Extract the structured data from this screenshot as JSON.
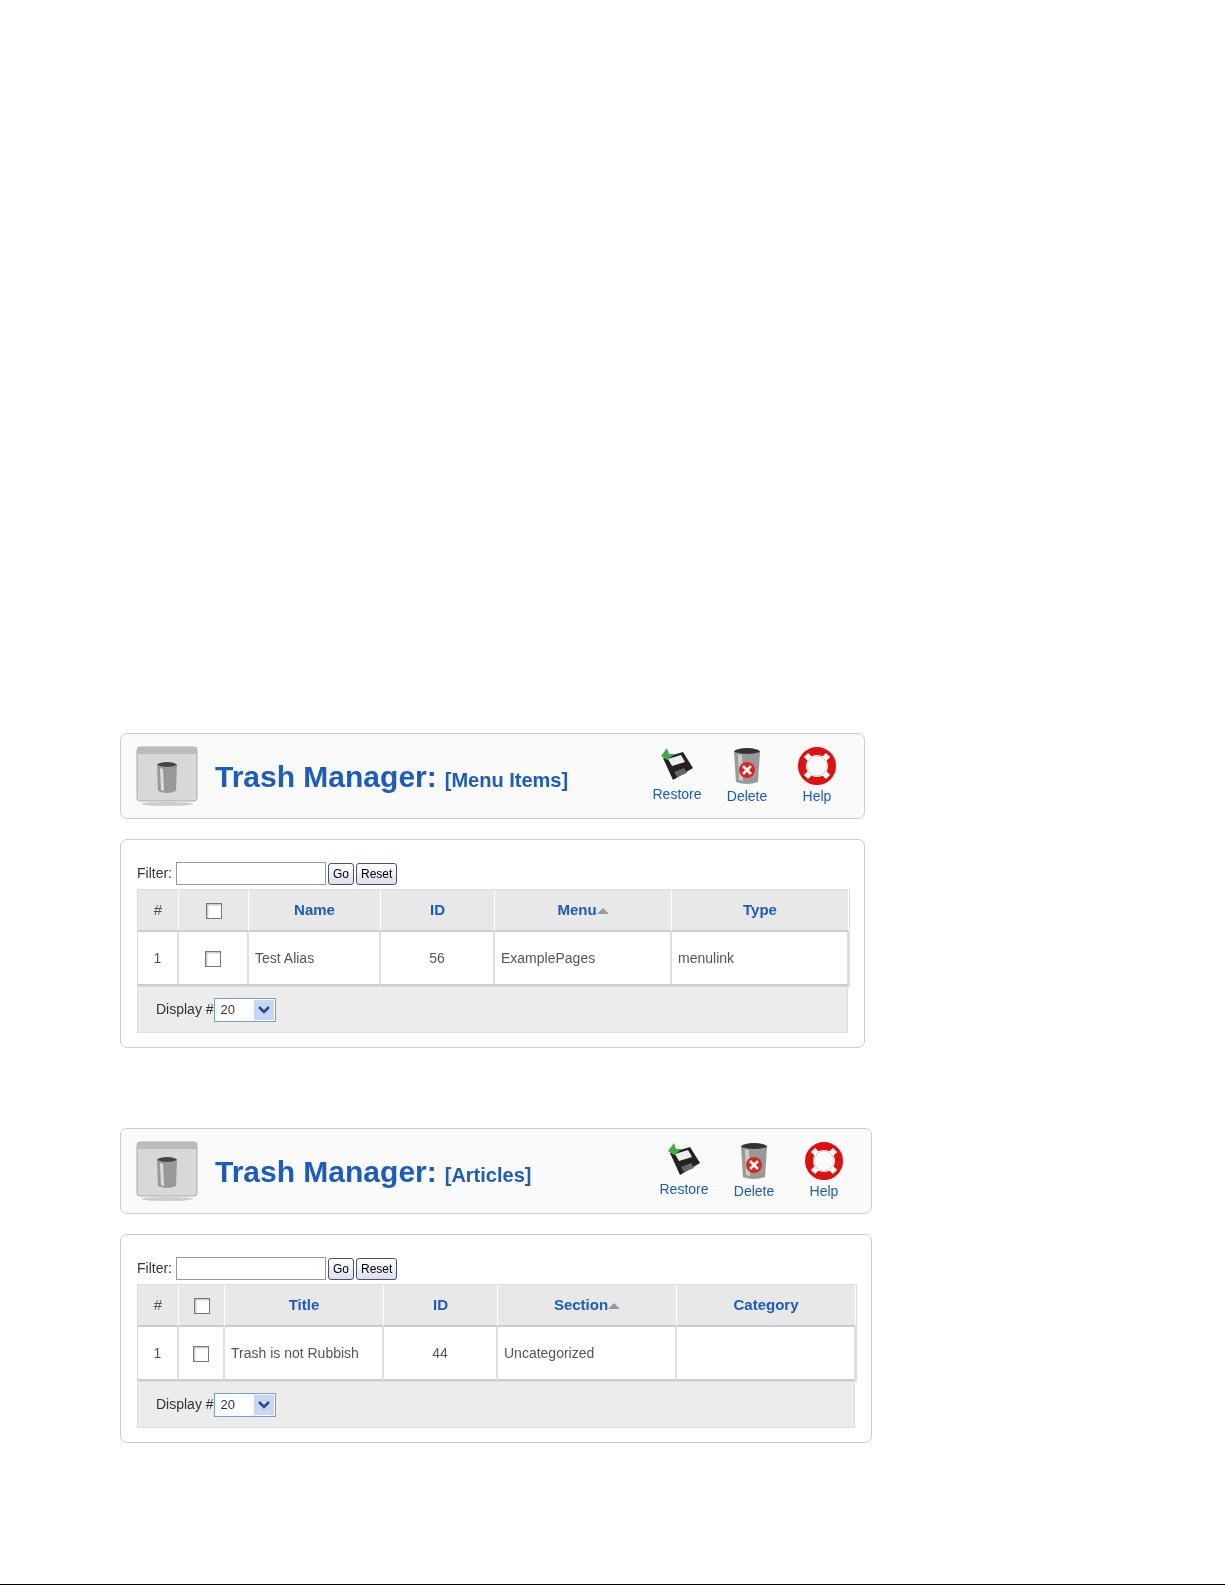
{
  "screens": [
    {
      "title": "Trash Manager:",
      "subtitle": "[Menu Items]",
      "toolbar": [
        {
          "kind": "restore",
          "label": "Restore"
        },
        {
          "kind": "delete",
          "label": "Delete"
        },
        {
          "kind": "help",
          "label": "Help"
        }
      ],
      "filter": {
        "label": "Filter:",
        "buttons": [
          "Go",
          "Reset"
        ]
      },
      "table": {
        "columns": [
          {
            "kind": "text",
            "label": "#"
          },
          {
            "kind": "checkbox",
            "checked": false
          },
          {
            "kind": "sortable",
            "label": "Name",
            "sorted": false
          },
          {
            "kind": "sortable",
            "label": "ID",
            "sorted": false
          },
          {
            "kind": "sortable",
            "label": "Menu",
            "sorted": true
          },
          {
            "kind": "sortable",
            "label": "Type",
            "sorted": false
          }
        ],
        "rows": [
          {
            "cells": [
              "1",
              {
                "kind": "checkbox",
                "checked": false
              },
              "Test Alias",
              "56",
              "ExamplePages",
              "menulink"
            ]
          }
        ]
      },
      "display": {
        "label": "Display #",
        "value": "20"
      }
    },
    {
      "title": "Trash Manager:",
      "subtitle": "[Articles]",
      "toolbar": [
        {
          "kind": "restore",
          "label": "Restore"
        },
        {
          "kind": "delete",
          "label": "Delete"
        },
        {
          "kind": "help",
          "label": "Help"
        }
      ],
      "filter": {
        "label": "Filter:",
        "buttons": [
          "Go",
          "Reset"
        ]
      },
      "table": {
        "columns": [
          {
            "kind": "text",
            "label": "#"
          },
          {
            "kind": "checkbox",
            "checked": false
          },
          {
            "kind": "sortable",
            "label": "Title",
            "sorted": false
          },
          {
            "kind": "sortable",
            "label": "ID",
            "sorted": false
          },
          {
            "kind": "sortable",
            "label": "Section",
            "sorted": true
          },
          {
            "kind": "sortable",
            "label": "Category",
            "sorted": false
          }
        ],
        "rows": [
          {
            "cells": [
              "1",
              {
                "kind": "checkbox",
                "checked": false
              },
              "Trash is not Rubbish",
              "44",
              "Uncategorized",
              null
            ]
          }
        ]
      },
      "display": {
        "label": "Display #",
        "value": "20"
      }
    }
  ]
}
